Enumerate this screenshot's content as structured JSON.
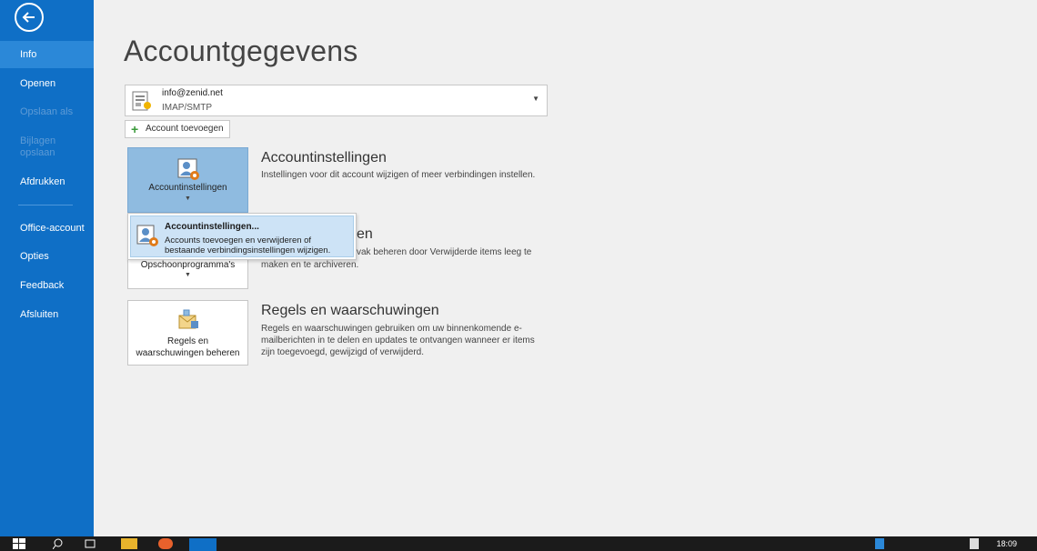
{
  "sidebar": {
    "items": [
      {
        "label": "Info",
        "state": "active"
      },
      {
        "label": "Openen",
        "state": "normal"
      },
      {
        "label": "Opslaan als",
        "state": "disabled"
      },
      {
        "label": "Bijlagen opslaan",
        "state": "disabled"
      },
      {
        "label": "Afdrukken",
        "state": "normal"
      },
      {
        "label": "Office-account",
        "state": "normal"
      },
      {
        "label": "Opties",
        "state": "normal"
      },
      {
        "label": "Feedback",
        "state": "normal"
      },
      {
        "label": "Afsluiten",
        "state": "normal"
      }
    ],
    "accent": "#0f6fc6"
  },
  "page": {
    "title": "Accountgegevens"
  },
  "account": {
    "email": "info@zenid.net",
    "type": "IMAP/SMTP",
    "add_label": "Account toevoegen"
  },
  "sections": {
    "account_settings": {
      "tile_label": "Accountinstellingen",
      "title": "Accountinstellingen",
      "desc": "Instellingen voor dit account wijzigen of meer verbindingen instellen."
    },
    "cleanup": {
      "tile_label": "Opschoonprogramma's",
      "title_partial": "en",
      "desc_line1": "vak beheren door Verwijderde items leeg te",
      "desc_line2": "maken en te archiveren."
    },
    "rules": {
      "tile_label_1": "Regels en",
      "tile_label_2": "waarschuwingen beheren",
      "title": "Regels en waarschuwingen",
      "desc_line1": "Regels en waarschuwingen gebruiken om uw binnenkomende e-",
      "desc_line2": "mailberichten in te delen en updates te ontvangen wanneer er items",
      "desc_line3": "zijn toegevoegd, gewijzigd of verwijderd."
    }
  },
  "popup": {
    "title": "Accountinstellingen...",
    "desc_line1": "Accounts toevoegen en verwijderen of",
    "desc_line2": "bestaande verbindingsinstellingen wijzigen."
  },
  "taskbar": {
    "clock": "18:09"
  }
}
